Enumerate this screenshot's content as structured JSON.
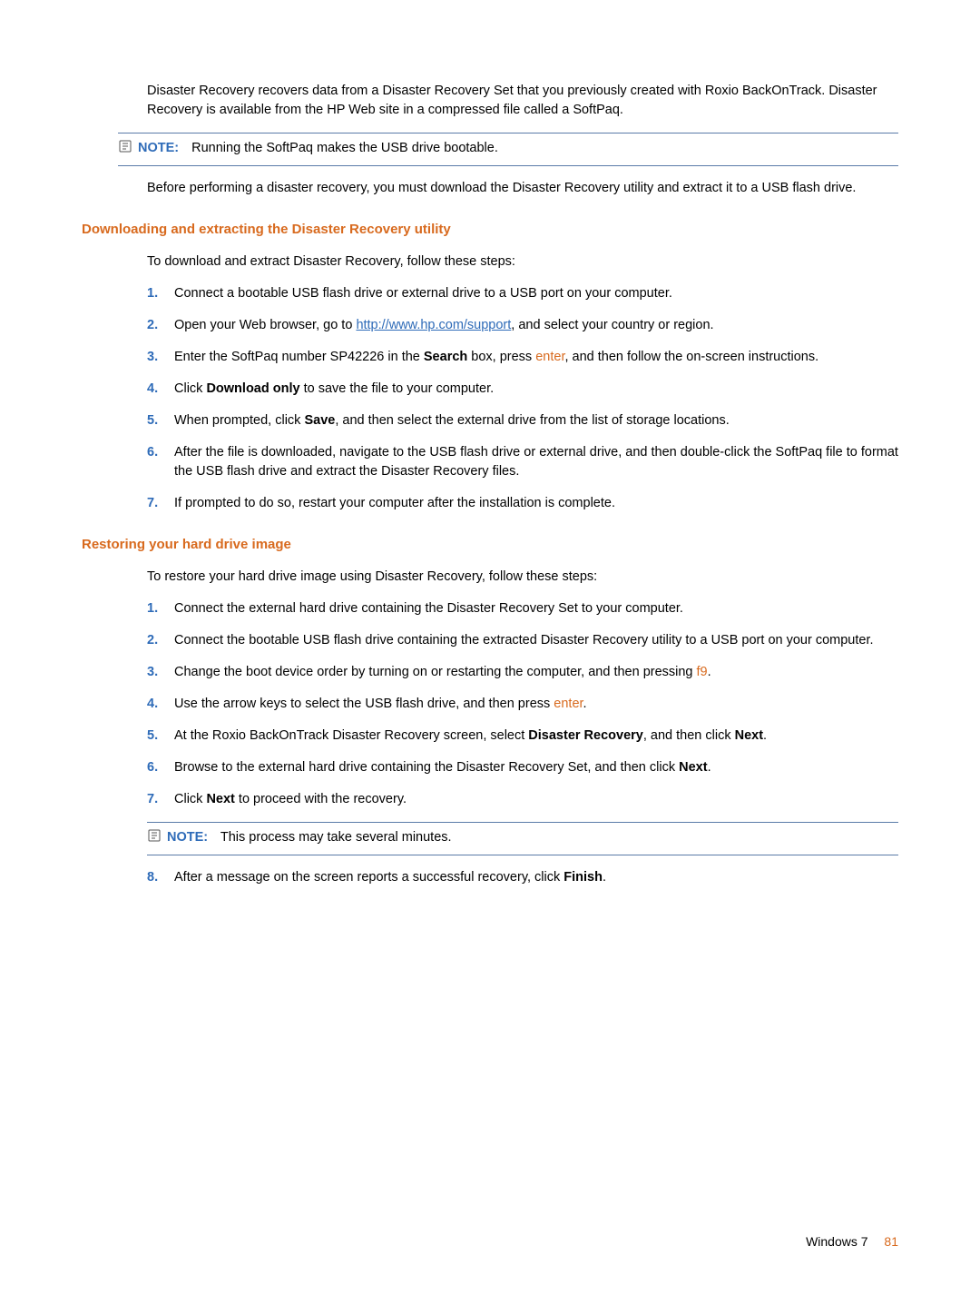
{
  "intro": "Disaster Recovery recovers data from a Disaster Recovery Set that you previously created with Roxio BackOnTrack. Disaster Recovery is available from the HP Web site in a compressed file called a SoftPaq.",
  "note1_label": "NOTE:",
  "note1_text": "Running the SoftPaq makes the USB drive bootable.",
  "before_text": "Before performing a disaster recovery, you must download the Disaster Recovery utility and extract it to a USB flash drive.",
  "h1": "Downloading and extracting the Disaster Recovery utility",
  "h1_intro": "To download and extract Disaster Recovery, follow these steps:",
  "s1": {
    "n1": "1.",
    "t1": "Connect a bootable USB flash drive or external drive to a USB port on your computer.",
    "n2": "2.",
    "t2a": "Open your Web browser, go to ",
    "t2_link": "http://www.hp.com/support",
    "t2b": ", and select your country or region.",
    "n3": "3.",
    "t3a": "Enter the SoftPaq number SP42226 in the ",
    "t3_bold1": "Search",
    "t3b": " box, press ",
    "t3_action": "enter",
    "t3c": ", and then follow the on-screen instructions.",
    "n4": "4.",
    "t4a": "Click ",
    "t4_bold": "Download only",
    "t4b": " to save the file to your computer.",
    "n5": "5.",
    "t5a": "When prompted, click ",
    "t5_bold": "Save",
    "t5b": ", and then select the external drive from the list of storage locations.",
    "n6": "6.",
    "t6": "After the file is downloaded, navigate to the USB flash drive or external drive, and then double-click the SoftPaq file to format the USB flash drive and extract the Disaster Recovery files.",
    "n7": "7.",
    "t7": "If prompted to do so, restart your computer after the installation is complete."
  },
  "h2": "Restoring your hard drive image",
  "h2_intro": "To restore your hard drive image using Disaster Recovery, follow these steps:",
  "s2": {
    "n1": "1.",
    "t1": "Connect the external hard drive containing the Disaster Recovery Set to your computer.",
    "n2": "2.",
    "t2": "Connect the bootable USB flash drive containing the extracted Disaster Recovery utility to a USB port on your computer.",
    "n3": "3.",
    "t3a": "Change the boot device order by turning on or restarting the computer, and then pressing ",
    "t3_action": "f9",
    "t3b": ".",
    "n4": "4.",
    "t4a": "Use the arrow keys to select the USB flash drive, and then press ",
    "t4_action": "enter",
    "t4b": ".",
    "n5": "5.",
    "t5a": "At the Roxio BackOnTrack Disaster Recovery screen, select ",
    "t5_bold1": "Disaster Recovery",
    "t5b": ", and then click ",
    "t5_bold2": "Next",
    "t5c": ".",
    "n6": "6.",
    "t6a": "Browse to the external hard drive containing the Disaster Recovery Set, and then click ",
    "t6_bold": "Next",
    "t6b": ".",
    "n7": "7.",
    "t7a": "Click ",
    "t7_bold": "Next",
    "t7b": " to proceed with the recovery.",
    "n8": "8.",
    "t8a": "After a message on the screen reports a successful recovery, click ",
    "t8_bold": "Finish",
    "t8b": "."
  },
  "note2_label": "NOTE:",
  "note2_text": "This process may take several minutes.",
  "footer_section": "Windows 7",
  "footer_page": "81"
}
